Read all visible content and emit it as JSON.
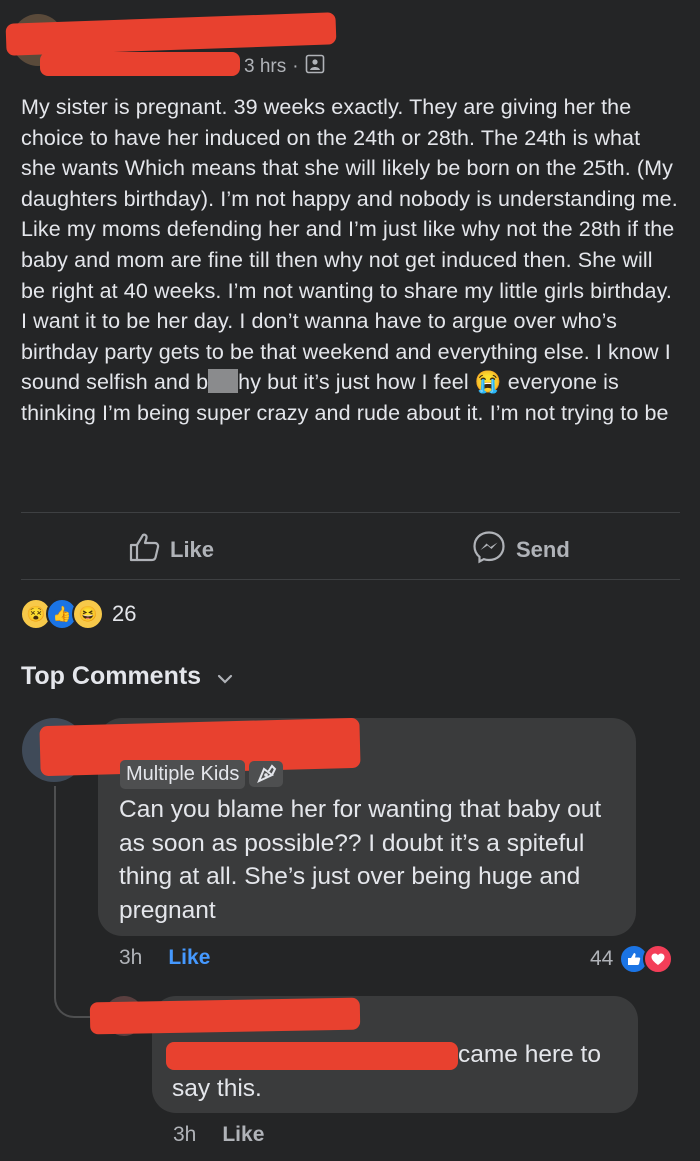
{
  "post": {
    "timestamp": "3 hrs",
    "separator": "·",
    "privacy_icon": "group-icon",
    "text_part1": "My sister is pregnant. 39 weeks exactly. They are giving her the choice to have her induced on the 24th or 28th. The 24th is what she wants Which means that she will likely be born on the 25th. (My daughters birthday). I’m not happy and nobody is understanding me. Like my moms defending her and I’m just like why not the 28th if the baby and mom are fine till then why not get induced then. She will be right at 40 weeks. I’m not wanting to share my little girls birthday. I want it to be her day. I don’t wanna have to argue over who’s birthday party gets to be that weekend and everything else. I know I sound selfish and b",
    "text_part2": "hy but it’s just how I feel ",
    "emoji": "😭",
    "text_part3": " everyone is thinking I’m being super crazy and rude about it. I’m not trying to be"
  },
  "actions": {
    "like_label": "Like",
    "send_label": "Send"
  },
  "reactions": {
    "icons": [
      "😵",
      "👍",
      "😆"
    ],
    "count": "26"
  },
  "comments_header": {
    "label": "Top Comments"
  },
  "comments": [
    {
      "badge": "Multiple Kids",
      "text": "Can you blame her for wanting that baby out as soon as possible?? I doubt it’s a spiteful thing at all. She’s just over being huge and pregnant",
      "time": "3h",
      "like_label": "Like",
      "reaction_count": "44"
    },
    {
      "text_visible_end": "came here to",
      "text_line2": "say this.",
      "time": "3h",
      "like_label": "Like"
    }
  ],
  "colors": {
    "background": "#242526",
    "bubble": "#3a3b3c",
    "redaction": "#e8412f",
    "link_blue": "#4599ff"
  }
}
